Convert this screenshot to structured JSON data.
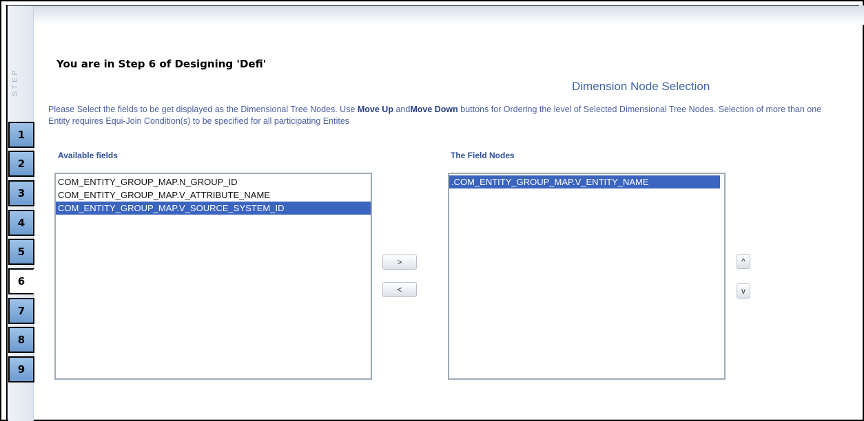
{
  "sidebar": {
    "step_label": "STEP",
    "steps": [
      "1",
      "2",
      "3",
      "4",
      "5",
      "6",
      "7",
      "8",
      "9"
    ],
    "active_step": "6"
  },
  "heading": "You are in Step 6 of Designing 'Defi'",
  "section_title": "Dimension Node Selection",
  "instructions": {
    "part1": "Please Select the fields to be get displayed as the Dimensional Tree Nodes. Use ",
    "move_up": "Move Up",
    "part2": " and",
    "move_down": "Move Down",
    "part3": " buttons for Ordering the level of Selected Dimensional Tree Nodes. Selection of more than one Entity requires Equi-Join Condition(s) to be specified for all participating Entites"
  },
  "available": {
    "label": "Available fields",
    "items": [
      {
        "text": "COM_ENTITY_GROUP_MAP.N_GROUP_ID",
        "selected": false
      },
      {
        "text": "COM_ENTITY_GROUP_MAP.V_ATTRIBUTE_NAME",
        "selected": false
      },
      {
        "text": "COM_ENTITY_GROUP_MAP.V_SOURCE_SYSTEM_ID",
        "selected": true
      }
    ]
  },
  "field_nodes": {
    "label": "The Field Nodes",
    "items": [
      {
        "text": ".COM_ENTITY_GROUP_MAP.V_ENTITY_NAME",
        "selected": true
      }
    ]
  },
  "buttons": {
    "add": ">",
    "remove": "<",
    "move_up": "^",
    "move_down": "v"
  }
}
